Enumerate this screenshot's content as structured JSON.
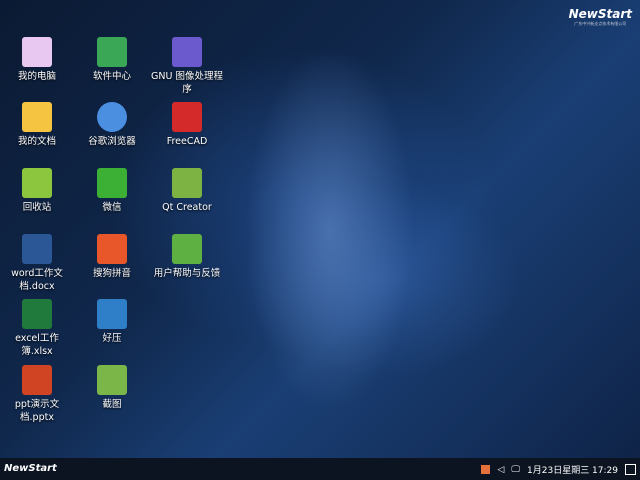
{
  "brand": {
    "logo": "NewStart",
    "logo_sub": "广东中兴新支点技术有限公司"
  },
  "icons": [
    {
      "label": "我的电脑",
      "icon": "computer-icon",
      "color": "#e8c8f0"
    },
    {
      "label": "我的文档",
      "icon": "folder-icon",
      "color": "#f5c542"
    },
    {
      "label": "回收站",
      "icon": "recycle-bin-icon",
      "color": "#8cc63f"
    },
    {
      "label": "word工作文档.docx",
      "icon": "word-doc-icon",
      "color": "#2b5797"
    },
    {
      "label": "excel工作簿.xlsx",
      "icon": "excel-icon",
      "color": "#1f7a3c"
    },
    {
      "label": "ppt演示文档.pptx",
      "icon": "ppt-icon",
      "color": "#d04423"
    },
    {
      "label": "软件中心",
      "icon": "software-center-icon",
      "color": "#3aa757"
    },
    {
      "label": "谷歌浏览器",
      "icon": "chrome-icon",
      "color": "#4a8fe0"
    },
    {
      "label": "微信",
      "icon": "wechat-icon",
      "color": "#3cb034"
    },
    {
      "label": "搜狗拼音",
      "icon": "sogou-icon",
      "color": "#e8572a"
    },
    {
      "label": "好压",
      "icon": "haozip-icon",
      "color": "#2f7fc8"
    },
    {
      "label": "截图",
      "icon": "screenshot-icon",
      "color": "#7ab648"
    },
    {
      "label": "GNU 图像处理程序",
      "icon": "gimp-icon",
      "color": "#6a5acd"
    },
    {
      "label": "FreeCAD",
      "icon": "freecad-icon",
      "color": "#d42a2a"
    },
    {
      "label": "Qt Creator",
      "icon": "qt-icon",
      "color": "#7cb342"
    },
    {
      "label": "用户帮助与反馈",
      "icon": "help-icon",
      "color": "#5fb043"
    }
  ],
  "taskbar": {
    "start": "NewStart",
    "datetime": "1月23日星期三 17:29"
  }
}
